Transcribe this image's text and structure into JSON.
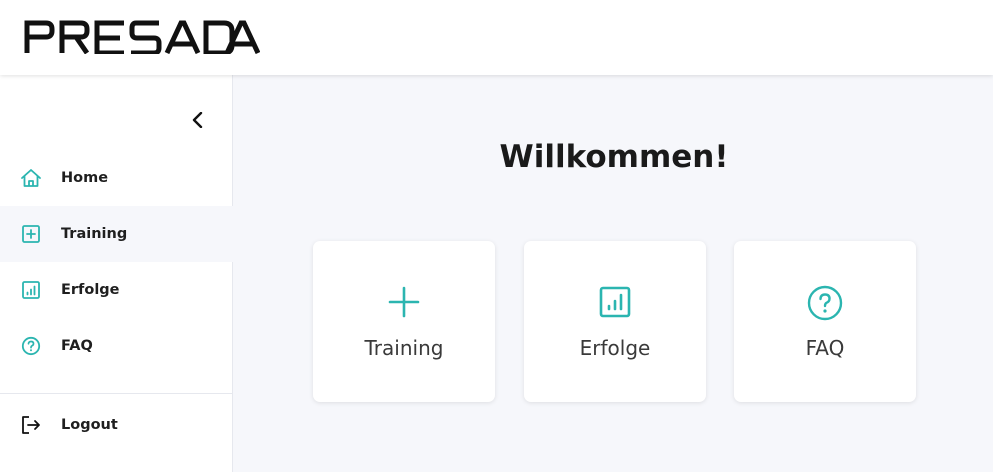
{
  "header": {
    "logo_text": "PRESADA"
  },
  "sidebar": {
    "items": [
      {
        "label": "Home",
        "icon": "home-icon"
      },
      {
        "label": "Training",
        "icon": "plus-square-icon",
        "active": true
      },
      {
        "label": "Erfolge",
        "icon": "bar-chart-icon"
      },
      {
        "label": "FAQ",
        "icon": "question-circle-icon"
      }
    ],
    "logout_label": "Logout"
  },
  "main": {
    "title": "Willkommen!",
    "cards": [
      {
        "label": "Training",
        "icon": "plus-icon"
      },
      {
        "label": "Erfolge",
        "icon": "bar-chart-icon"
      },
      {
        "label": "FAQ",
        "icon": "question-circle-icon"
      }
    ]
  },
  "colors": {
    "accent": "#2bb5b0",
    "background": "#f6f7fb",
    "text": "#1a1a1a"
  }
}
